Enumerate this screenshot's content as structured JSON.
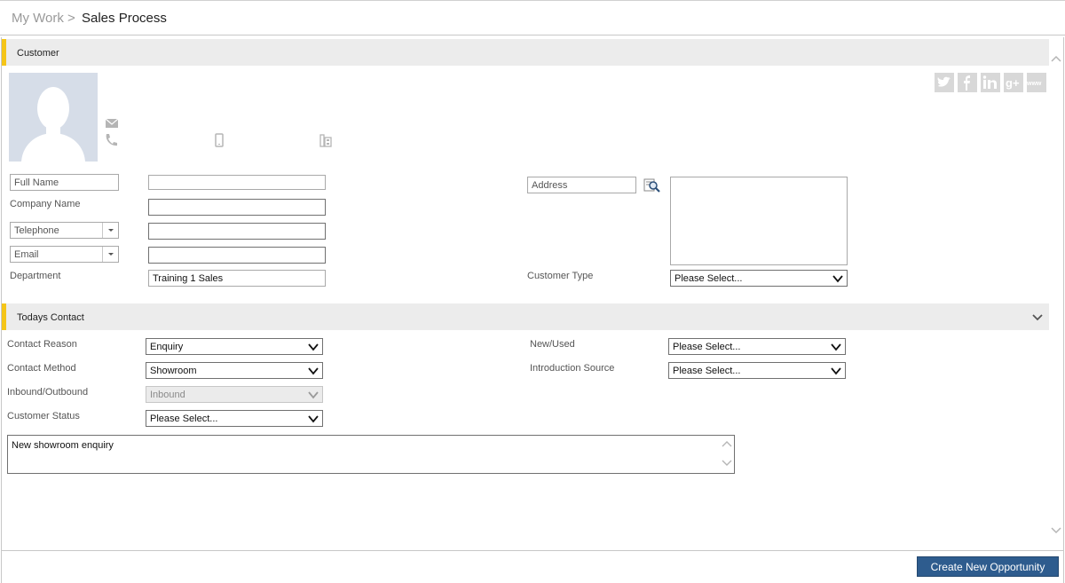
{
  "breadcrumb": {
    "root": "My Work",
    "separator": ">",
    "current": "Sales Process"
  },
  "customer": {
    "section_title": "Customer",
    "social": [
      {
        "name": "twitter-icon",
        "glyph": "t"
      },
      {
        "name": "facebook-icon",
        "glyph": "f"
      },
      {
        "name": "linkedin-icon",
        "glyph": "in"
      },
      {
        "name": "googleplus-icon",
        "glyph": "g+"
      },
      {
        "name": "website-icon",
        "glyph": "www"
      }
    ],
    "full_name_label": "Full Name",
    "full_name_value": "",
    "company_name_label": "Company Name",
    "company_name_value": "",
    "telephone_label": "Telephone",
    "telephone_value": "",
    "email_label": "Email",
    "email_value": "",
    "department_label": "Department",
    "department_value": "Training 1 Sales",
    "address_label": "Address",
    "address_value": "",
    "customer_type_label": "Customer Type",
    "customer_type_value": "Please Select..."
  },
  "todays_contact": {
    "section_title": "Todays Contact",
    "contact_reason_label": "Contact Reason",
    "contact_reason_value": "Enquiry",
    "contact_method_label": "Contact Method",
    "contact_method_value": "Showroom",
    "inbound_outbound_label": "Inbound/Outbound",
    "inbound_outbound_value": "Inbound",
    "customer_status_label": "Customer Status",
    "customer_status_value": "Please Select...",
    "new_used_label": "New/Used",
    "new_used_value": "Please Select...",
    "introduction_source_label": "Introduction Source",
    "introduction_source_value": "Please Select...",
    "notes_value": "New showroom enquiry"
  },
  "actions": {
    "create_opportunity_label": "Create New Opportunity"
  },
  "colors": {
    "accent": "#f5c518",
    "primary_button": "#2e5c8e"
  }
}
